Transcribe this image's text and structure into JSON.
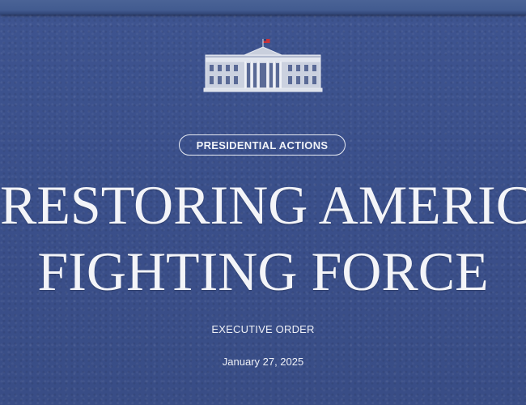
{
  "header": {
    "logo_icon": "white-house-icon"
  },
  "article": {
    "category": "PRESIDENTIAL ACTIONS",
    "title_line_1": "RESTORING AMERICA’S",
    "title_line_2": "FIGHTING FORCE",
    "document_type": "EXECUTIVE ORDER",
    "date": "January 27, 2025"
  },
  "colors": {
    "background": "#3b5089",
    "text": "#f3f4f8",
    "flag_red": "#c8323a"
  }
}
